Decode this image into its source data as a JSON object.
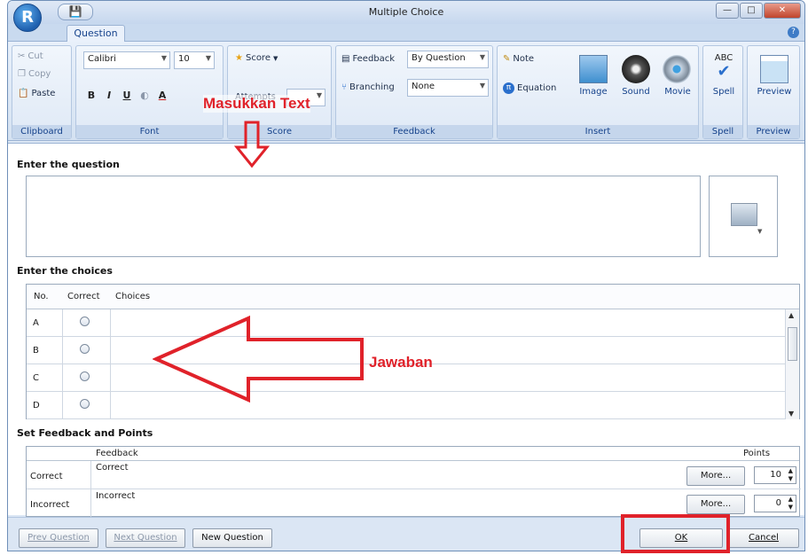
{
  "window": {
    "title": "Multiple Choice",
    "orb_letter": "R",
    "save_glyph": "💾",
    "win_minimize": "—",
    "win_maximize": "□",
    "win_close": "✕"
  },
  "tabs": [
    {
      "label": "Question"
    }
  ],
  "help_glyph": "?",
  "ribbon": {
    "clipboard": {
      "label": "Clipboard",
      "cut": "Cut",
      "copy": "Copy",
      "paste": "Paste"
    },
    "font": {
      "label": "Font",
      "family": "Calibri",
      "size": "10",
      "bold": "B",
      "italic": "I",
      "underline": "U",
      "color": "A"
    },
    "score": {
      "label": "Score",
      "button": "Score",
      "attempts_label": "Attempts"
    },
    "feedback": {
      "label": "Feedback",
      "feedback_button": "Feedback",
      "feedback_value": "By Question",
      "branching_button": "Branching",
      "branching_value": "None"
    },
    "insert": {
      "label": "Insert",
      "note": "Note",
      "equation": "Equation",
      "image": "Image",
      "sound": "Sound",
      "movie": "Movie"
    },
    "spell": {
      "label": "Spell",
      "button": "Spell",
      "abc": "ABC"
    },
    "preview": {
      "label": "Preview",
      "button": "Preview"
    }
  },
  "question_section": {
    "heading": "Enter the question",
    "value": ""
  },
  "choices_section": {
    "heading": "Enter the choices",
    "columns": [
      "No.",
      "Correct",
      "Choices"
    ],
    "rows": [
      {
        "letter": "A",
        "text": ""
      },
      {
        "letter": "B",
        "text": ""
      },
      {
        "letter": "C",
        "text": ""
      },
      {
        "letter": "D",
        "text": ""
      }
    ]
  },
  "feedback_section": {
    "heading": "Set Feedback and Points",
    "columns": [
      "Feedback",
      "Points"
    ],
    "rows": [
      {
        "label": "Correct",
        "feedback": "Correct",
        "more": "More...",
        "points": "10"
      },
      {
        "label": "Incorrect",
        "feedback": "Incorrect",
        "more": "More...",
        "points": "0"
      }
    ]
  },
  "buttons": {
    "prev": "Prev Question",
    "next": "Next Question",
    "new": "New Question",
    "ok": "OK",
    "cancel": "Cancel"
  },
  "annotations": {
    "masukkan": "Masukkan Text",
    "jawaban": "Jawaban",
    "color": "#e0222a"
  }
}
